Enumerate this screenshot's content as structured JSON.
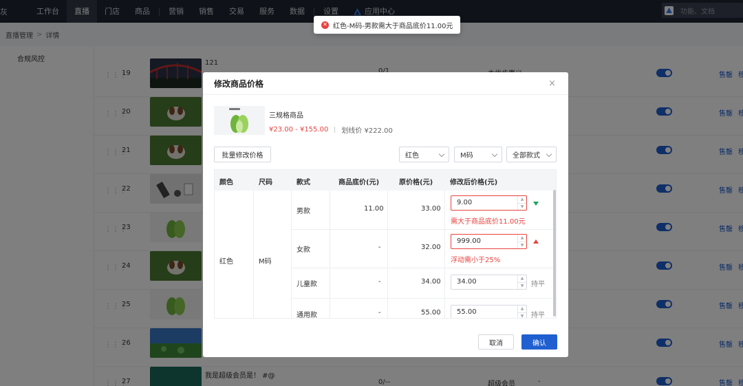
{
  "topnav": {
    "brand": "灰",
    "items": [
      "工作台",
      "直播",
      "门店",
      "商品",
      "营销",
      "销售",
      "交易",
      "服务",
      "数据",
      "设置"
    ],
    "active": "直播",
    "app_center": "应用中心",
    "search_placeholder": "功能、文档"
  },
  "breadcrumb": {
    "parent": "直播管理",
    "sep": ">",
    "current": "详情"
  },
  "sidebar": {
    "items": [
      "合规风控"
    ]
  },
  "bg_rows": [
    {
      "num": "19",
      "title": "121",
      "col3": "0/1",
      "col4": "本优步惠义"
    },
    {
      "num": "20"
    },
    {
      "num": "21"
    },
    {
      "num": "22"
    },
    {
      "num": "23"
    },
    {
      "num": "24"
    },
    {
      "num": "25"
    },
    {
      "num": "26"
    },
    {
      "num": "27",
      "title": "我是超级会员是！ #@",
      "col3": "0/--",
      "col4": "超级会员",
      "col5": "-"
    }
  ],
  "row_actions": {
    "sell_out": "售罄",
    "move": "移"
  },
  "toast": {
    "message": "红色-M码-男款需大于商品底价11.00元"
  },
  "modal": {
    "title": "修改商品价格",
    "close": "×",
    "product": {
      "name": "三规格商品",
      "price_range": "¥23.00 - ¥155.00",
      "strike_label": "划线价 ¥222.00"
    },
    "batch_button": "批量修改价格",
    "filters": {
      "color": "红色",
      "size": "M码",
      "style": "全部款式"
    },
    "columns": [
      "颜色",
      "尺码",
      "款式",
      "商品底价(元)",
      "原价格(元)",
      "修改后价格(元)"
    ],
    "group": {
      "color": "红色",
      "size": "M码"
    },
    "rows": [
      {
        "style": "男款",
        "base": "11.00",
        "orig": "33.00",
        "new": "9.00",
        "error": "需大于商品底价11.00元",
        "trend": "down"
      },
      {
        "style": "女款",
        "base": "-",
        "orig": "32.00",
        "new": "999.00",
        "error": "浮动需小于25%",
        "trend": "up"
      },
      {
        "style": "儿童款",
        "base": "-",
        "orig": "34.00",
        "new": "34.00",
        "flat": "持平"
      },
      {
        "style": "通用款",
        "base": "-",
        "orig": "55.00",
        "new": "55.00",
        "flat": "持平"
      }
    ],
    "cancel": "取消",
    "confirm": "确认"
  }
}
